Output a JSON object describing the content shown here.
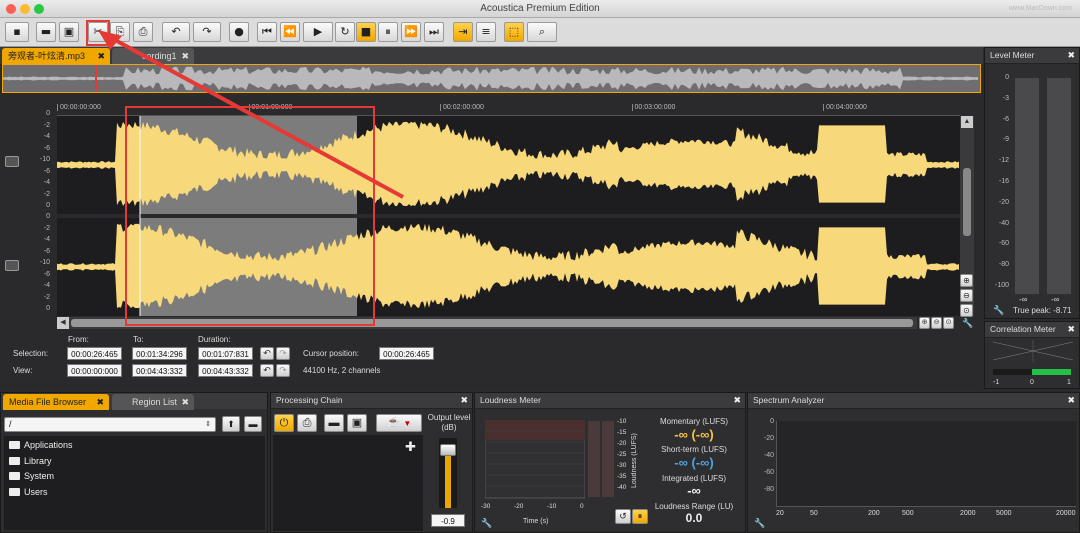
{
  "window": {
    "title": "Acoustica Premium Edition",
    "watermark": "www.MacDown.com"
  },
  "toolbar": {
    "buttons": [
      {
        "name": "new-file",
        "glyph": "▪"
      },
      {
        "name": "open-file",
        "glyph": "▬"
      },
      {
        "name": "save-file",
        "glyph": "▣"
      },
      {
        "name": "cut",
        "glyph": "✂"
      },
      {
        "name": "copy",
        "glyph": "⎘"
      },
      {
        "name": "paste",
        "glyph": "⎙"
      },
      {
        "name": "undo",
        "glyph": "↶"
      },
      {
        "name": "redo",
        "glyph": "↷"
      },
      {
        "name": "record",
        "glyph": "●"
      },
      {
        "name": "go-start",
        "glyph": "⏮"
      },
      {
        "name": "rewind",
        "glyph": "⏪"
      },
      {
        "name": "play",
        "glyph": "▶"
      },
      {
        "name": "loop",
        "glyph": "↻"
      },
      {
        "name": "stop",
        "glyph": "■"
      },
      {
        "name": "pause",
        "glyph": "⏸"
      },
      {
        "name": "fast-forward",
        "glyph": "⏩"
      },
      {
        "name": "go-end",
        "glyph": "⏭"
      },
      {
        "name": "follow",
        "glyph": "⇥"
      },
      {
        "name": "spectrum-view",
        "glyph": "≡"
      },
      {
        "name": "select-tool",
        "glyph": "⬚"
      },
      {
        "name": "zoom-tool",
        "glyph": "⌕"
      }
    ]
  },
  "editor": {
    "tabs": [
      {
        "label": "旁观者-叶炫清.mp3",
        "close": "✖"
      },
      {
        "label": "cording1",
        "close": "✖"
      }
    ],
    "timeline": [
      "00:00:00:000",
      "00:01:00:000",
      "00:02:00:000",
      "00:03:00:000",
      "00:04:00:000"
    ],
    "db_scale": [
      "0",
      "-2",
      "-4",
      "-6",
      "-10",
      "-6",
      "-4",
      "-2",
      "0"
    ],
    "colors": {
      "waveform": "#f7d87a",
      "selection": "#7c7c7c",
      "background": "#1d1d1f",
      "accent": "#f0a800",
      "annotation": "#e53935"
    }
  },
  "selection": {
    "from_label": "From:",
    "to_label": "To:",
    "duration_label": "Duration:",
    "selection_label": "Selection:",
    "view_label": "View:",
    "sel_from": "00:00:26:465",
    "sel_to": "00:01:34:296",
    "sel_duration": "00:01:07:831",
    "view_from": "00:00:00:000",
    "view_to": "00:04:43:332",
    "view_duration": "00:04:43:332",
    "cursor_label": "Cursor position:",
    "cursor_value": "00:00:26:465",
    "format": "44100 Hz, 2 channels"
  },
  "level_meter": {
    "title": "Level Meter",
    "scale": [
      "0",
      "-3",
      "-6",
      "-9",
      "-12",
      "-16",
      "-20",
      "-40",
      "-60",
      "-80",
      "-100"
    ],
    "left_value": "-∞",
    "right_value": "-∞",
    "true_peak": "True peak: -8.71"
  },
  "correlation_meter": {
    "title": "Correlation Meter",
    "scale": [
      "-1",
      "0",
      "1"
    ]
  },
  "media_browser": {
    "tabs": [
      {
        "label": "Media File Browser",
        "close": "✖"
      },
      {
        "label": "Region List",
        "close": "✖"
      }
    ],
    "path": "/",
    "items": [
      "Applications",
      "Library",
      "System",
      "Users"
    ]
  },
  "processing_chain": {
    "title": "Processing Chain",
    "output_label": "Output level (dB)",
    "output_value": "-0.9",
    "add": "✚"
  },
  "loudness_meter": {
    "title": "Loudness Meter",
    "x_ticks": [
      "-30",
      "-20",
      "-10",
      "0"
    ],
    "x_label": "Time (s)",
    "y_ticks": [
      "-10",
      "-15",
      "-20",
      "-25",
      "-30",
      "-35",
      "-40"
    ],
    "y_label": "Loudness (LUFS)",
    "momentary_label": "Momentary (LUFS)",
    "momentary_value": "-∞ (-∞)",
    "shortterm_label": "Short-term (LUFS)",
    "shortterm_value": "-∞ (-∞)",
    "integrated_label": "Integrated (LUFS)",
    "integrated_value": "-∞",
    "range_label": "Loudness Range (LU)",
    "range_value": "0.0"
  },
  "spectrum_analyzer": {
    "title": "Spectrum Analyzer",
    "y_ticks": [
      "0",
      "-20",
      "-40",
      "-60",
      "-80"
    ],
    "x_ticks": [
      "20",
      "50",
      "200",
      "500",
      "2000",
      "5000",
      "20000"
    ]
  }
}
